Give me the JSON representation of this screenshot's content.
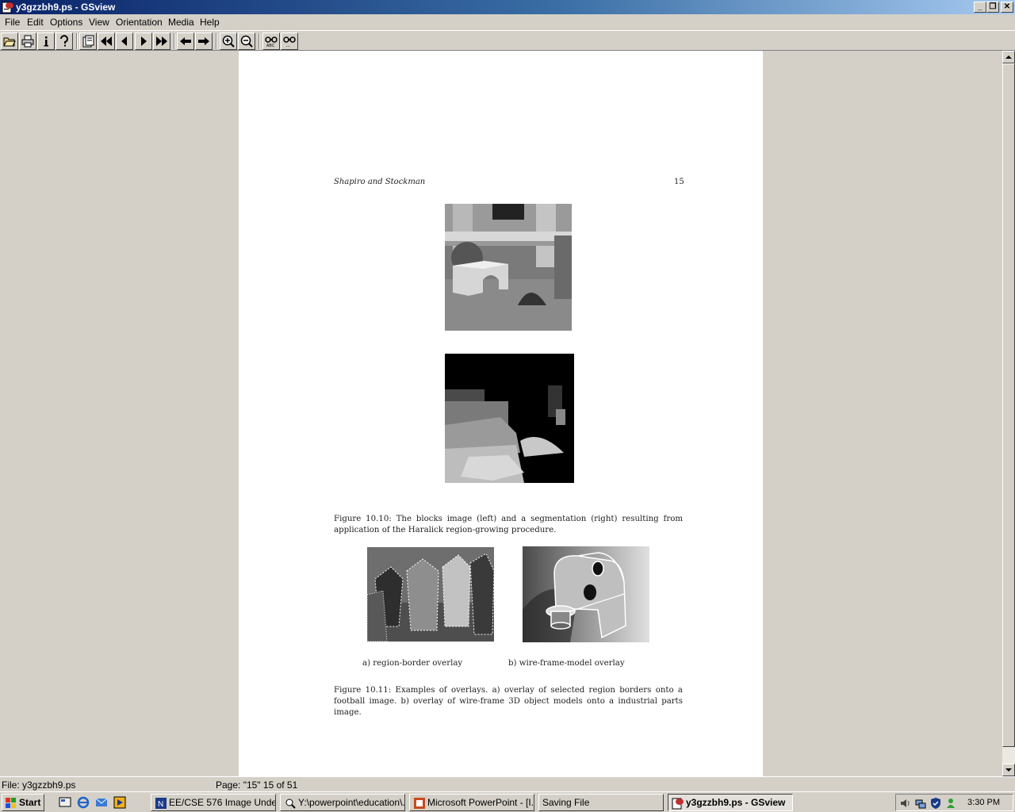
{
  "window": {
    "title": "y3gzzbh9.ps - GSview"
  },
  "menu": [
    "File",
    "Edit",
    "Options",
    "View",
    "Orientation",
    "Media",
    "Help"
  ],
  "toolbar": {
    "buttons": [
      "open-icon",
      "print-icon",
      "info-icon",
      "help-icon",
      "goto-page-icon",
      "first-page-icon",
      "prev-page-icon",
      "next-page-icon",
      "last-page-icon",
      "back-icon",
      "forward-icon",
      "zoom-in-icon",
      "zoom-out-icon",
      "find-icon",
      "find-next-icon"
    ]
  },
  "page": {
    "running_head_left": "Shapiro and Stockman",
    "running_head_right": "15",
    "figure_10_10_caption": "Figure 10.10: The blocks image (left) and a segmentation (right) resulting from application of the Haralick region-growing procedure.",
    "figure_10_11_sub_a": "a) region-border overlay",
    "figure_10_11_sub_b": "b) wire-frame-model overlay",
    "figure_10_11_caption": "Figure 10.11: Examples of overlays. a) overlay of selected region borders onto a football image. b) overlay of wire-frame 3D object models onto a industrial parts image."
  },
  "status": {
    "file": "File: y3gzzbh9.ps",
    "page": "Page: \"15\"  15 of 51"
  },
  "taskbar": {
    "start_label": "Start",
    "tasks": [
      "EE/CSE 576 Image Under...",
      "Y:\\powerpoint\\education\\...",
      "Microsoft PowerPoint - [I...",
      "Saving File",
      "y3gzzbh9.ps - GSview"
    ],
    "clock": "3:30 PM"
  },
  "colors": {
    "titlebar_start": "#0a246a",
    "titlebar_end": "#a6caf0",
    "chrome": "#d4d0c8",
    "page": "#ffffff"
  }
}
